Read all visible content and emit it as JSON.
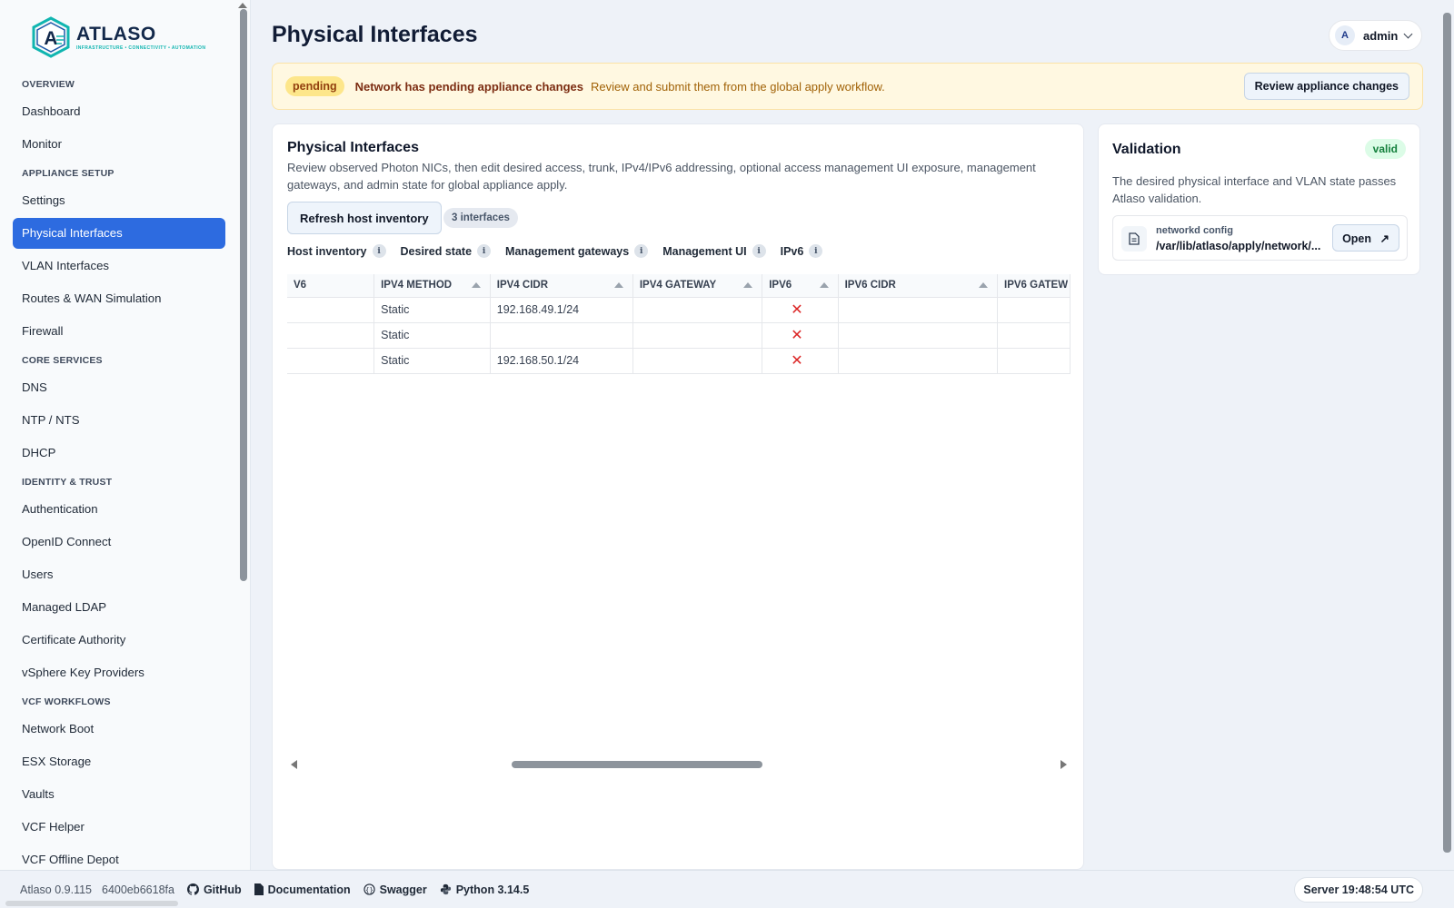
{
  "app": {
    "name": "ATLASO",
    "tagline": "INFRASTRUCTURE • CONNECTIVITY • AUTOMATION"
  },
  "sidebar": {
    "sections": [
      {
        "label": "OVERVIEW",
        "items": [
          {
            "label": "Dashboard"
          },
          {
            "label": "Monitor"
          }
        ]
      },
      {
        "label": "APPLIANCE SETUP",
        "items": [
          {
            "label": "Settings"
          },
          {
            "label": "Physical Interfaces",
            "active": true
          },
          {
            "label": "VLAN Interfaces"
          },
          {
            "label": "Routes & WAN Simulation"
          },
          {
            "label": "Firewall"
          }
        ]
      },
      {
        "label": "CORE SERVICES",
        "items": [
          {
            "label": "DNS"
          },
          {
            "label": "NTP / NTS"
          },
          {
            "label": "DHCP"
          }
        ]
      },
      {
        "label": "IDENTITY & TRUST",
        "items": [
          {
            "label": "Authentication"
          },
          {
            "label": "OpenID Connect"
          },
          {
            "label": "Users"
          },
          {
            "label": "Managed LDAP"
          },
          {
            "label": "Certificate Authority"
          },
          {
            "label": "vSphere Key Providers"
          }
        ]
      },
      {
        "label": "VCF WORKFLOWS",
        "items": [
          {
            "label": "Network Boot"
          },
          {
            "label": "ESX Storage"
          },
          {
            "label": "Vaults"
          },
          {
            "label": "VCF Helper"
          },
          {
            "label": "VCF Offline Depot"
          }
        ]
      }
    ]
  },
  "header": {
    "title": "Physical Interfaces",
    "user": {
      "avatar": "A",
      "name": "admin"
    }
  },
  "banner": {
    "badge": "pending",
    "title": "Network has pending appliance changes",
    "description": "Review and submit them from the global apply workflow.",
    "button": "Review appliance changes"
  },
  "main": {
    "title": "Physical Interfaces",
    "description": "Review observed Photon NICs, then edit desired access, trunk, IPv4/IPv6 addressing, optional access management UI exposure, management gateways, and admin state for global appliance apply.",
    "refresh_button": "Refresh host inventory",
    "count_badge": "3 interfaces",
    "legend": [
      "Host inventory",
      "Desired state",
      "Management gateways",
      "Management UI",
      "IPv6"
    ],
    "info_glyph": "i"
  },
  "table": {
    "columns": [
      "V6",
      "IPV4 METHOD",
      "IPV4 CIDR",
      "IPV4 GATEWAY",
      "IPV6",
      "IPV6 CIDR",
      "IPV6 GATEW"
    ],
    "rows": [
      [
        "",
        "Static",
        "192.168.49.1/24",
        "",
        "✕",
        "",
        ""
      ],
      [
        "",
        "Static",
        "",
        "",
        "✕",
        "",
        ""
      ],
      [
        "",
        "Static",
        "192.168.50.1/24",
        "",
        "✕",
        "",
        ""
      ]
    ]
  },
  "validation": {
    "title": "Validation",
    "badge": "valid",
    "description": "The desired physical interface and VLAN state passes Atlaso validation.",
    "file_label": "networkd config",
    "file_path": "/var/lib/atlaso/apply/network/...",
    "open_button": "Open",
    "open_icon": "↗"
  },
  "footer": {
    "version": "Atlaso 0.9.115",
    "hash": "6400eb6618fa",
    "links": [
      {
        "label": "GitHub",
        "icon": "github-icon"
      },
      {
        "label": "Documentation",
        "icon": "document-icon"
      },
      {
        "label": "Swagger",
        "icon": "swagger-icon"
      },
      {
        "label": "Python 3.14.5",
        "icon": "python-icon"
      }
    ],
    "server_time": "Server 19:48:54 UTC"
  },
  "colors": {
    "accent": "#2d6be0",
    "brand_navy": "#13294b",
    "brand_teal": "#10b5b0",
    "pending": "#fde68a",
    "valid": "#dcfce7",
    "error_mark": "#dc2626"
  }
}
